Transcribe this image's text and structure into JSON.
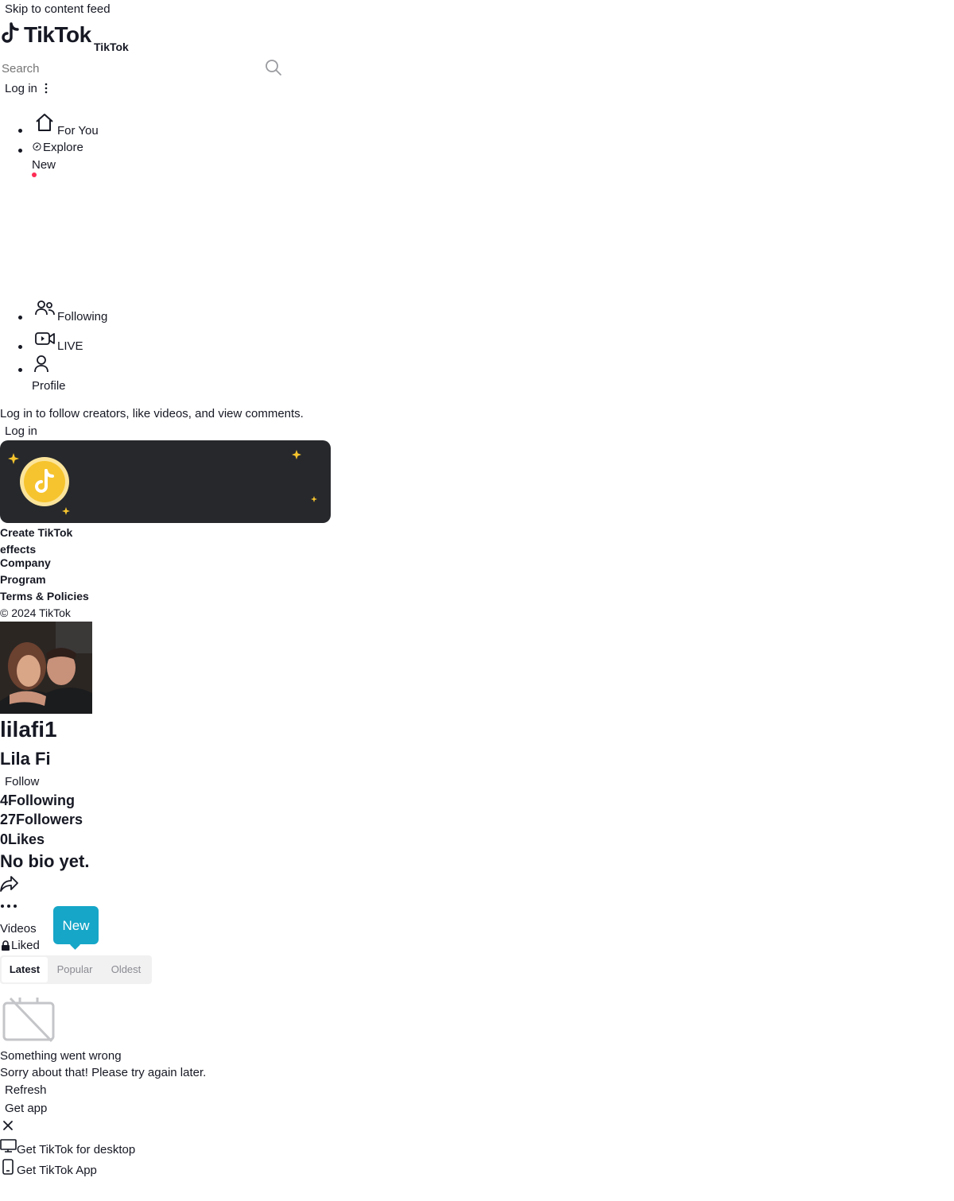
{
  "skip_link": "Skip to content feed",
  "header": {
    "logo_text": "TikTok",
    "logo_caption": "TikTok",
    "search_placeholder": "Search",
    "login_label": "Log in"
  },
  "nav": {
    "items": [
      {
        "label": "For You",
        "icon": "home-icon"
      },
      {
        "label": "Explore",
        "icon": "compass-icon"
      },
      {
        "label": "New"
      },
      {
        "label": "Following",
        "icon": "people-icon"
      },
      {
        "label": "LIVE",
        "icon": "live-camera-icon"
      },
      {
        "label": "Profile",
        "icon": "person-icon"
      }
    ]
  },
  "login_prompt": {
    "text": "Log in to follow creators, like videos, and view comments.",
    "button": "Log in"
  },
  "banner": {
    "icon": "tiktok-coin-icon"
  },
  "footer": {
    "links": [
      "Create TikTok effects",
      "Company",
      "Program",
      "Terms & Policies"
    ],
    "copyright": "© 2024 TikTok"
  },
  "profile": {
    "username": "lilafi1",
    "display_name": "Lila Fi",
    "follow_label": "Follow",
    "following_count": "4",
    "following_label": "Following",
    "followers_count": "27",
    "followers_label": "Followers",
    "likes_count": "0",
    "likes_label": "Likes",
    "bio": "No bio yet."
  },
  "tabs": {
    "videos": "Videos",
    "liked": "Liked",
    "new_badge": "New"
  },
  "sort": {
    "options": [
      "Latest",
      "Popular",
      "Oldest"
    ],
    "selected": "Latest"
  },
  "error": {
    "title": "Something went wrong",
    "message": "Sorry about that! Please try again later.",
    "refresh": "Refresh"
  },
  "get_app": {
    "label": "Get app",
    "desktop": "Get TikTok for desktop",
    "mobile": "Get TikTok App"
  },
  "colors": {
    "accent": "#FE2C55",
    "badge": "#16A6C8",
    "banner_bg": "#26282C",
    "coin": "#F6C42E"
  }
}
